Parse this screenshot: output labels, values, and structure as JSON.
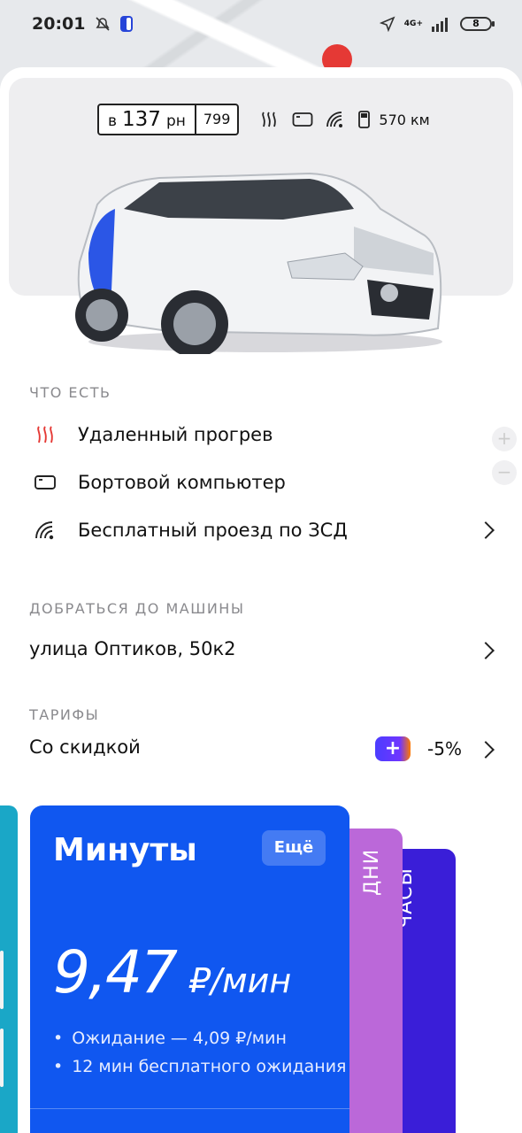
{
  "status_bar": {
    "time": "20:01",
    "network": "4G+",
    "battery": "8"
  },
  "car": {
    "plate_letter": "в",
    "plate_number": "137",
    "plate_suffix": "рн",
    "plate_region": "799",
    "fuel_range": "570 км",
    "feature_icons": [
      "heater-icon",
      "display-icon",
      "toll-icon",
      "fuel-icon"
    ]
  },
  "features": {
    "title": "ЧТО ЕСТЬ",
    "items": [
      {
        "label": "Удаленный прогрев",
        "icon": "heater-icon"
      },
      {
        "label": "Бортовой компьютер",
        "icon": "display-icon"
      },
      {
        "label": "Бесплатный проезд по ЗСД",
        "icon": "toll-icon"
      }
    ]
  },
  "reach": {
    "title": "ДОБРАТЬСЯ ДО МАШИНЫ",
    "address": "улица Оптиков, 50к2"
  },
  "tariffs": {
    "title": "ТАРИФЫ",
    "label": "Со скидкой",
    "plus_badge": "+",
    "discount": "-5%",
    "accent_color": "#1057f0"
  },
  "tariff_cards": {
    "minutes": {
      "title": "Минуты",
      "more": "Ещё",
      "price": "9,47",
      "unit": "₽/мин",
      "bullets": [
        "Ожидание — 4,09 ₽/мин",
        "12 мин бесплатного ожидания"
      ]
    },
    "days": {
      "title": "ДНИ"
    },
    "hours": {
      "title": "ЧАСЫ"
    }
  }
}
